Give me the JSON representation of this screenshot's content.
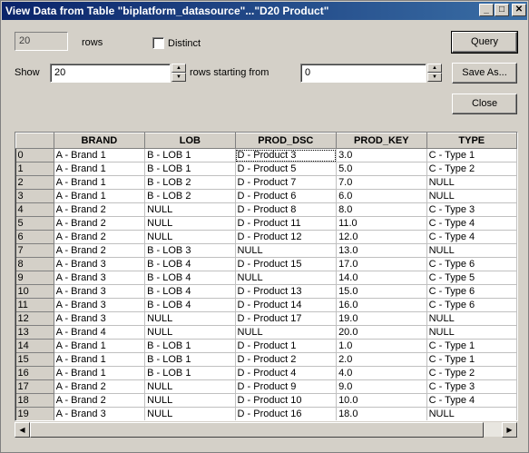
{
  "window": {
    "title": "View Data from Table \"biplatform_datasource\"...\"D20 Product\"",
    "minimize": "_",
    "maximize": "□",
    "close": "✕"
  },
  "controls": {
    "row_count": "20",
    "rows_label": "rows",
    "distinct_label": "Distinct",
    "distinct_checked": false,
    "show_label": "Show",
    "show_value": "20",
    "rows_starting_from_label": "rows starting from",
    "start_value": "0",
    "query_label": "Query",
    "save_as_label": "Save As...",
    "close_label": "Close"
  },
  "grid": {
    "columns": [
      "",
      "BRAND",
      "LOB",
      "PROD_DSC",
      "PROD_KEY",
      "TYPE"
    ],
    "rows": [
      [
        "0",
        "A - Brand 1",
        "B - LOB 1",
        "D - Product 3",
        "3.0",
        "C - Type 1"
      ],
      [
        "1",
        "A - Brand 1",
        "B - LOB 1",
        "D - Product 5",
        "5.0",
        "C - Type 2"
      ],
      [
        "2",
        "A - Brand 1",
        "B - LOB 2",
        "D - Product 7",
        "7.0",
        "NULL"
      ],
      [
        "3",
        "A - Brand 1",
        "B - LOB 2",
        "D - Product 6",
        "6.0",
        "NULL"
      ],
      [
        "4",
        "A - Brand 2",
        "NULL",
        "D - Product 8",
        "8.0",
        "C - Type 3"
      ],
      [
        "5",
        "A - Brand 2",
        "NULL",
        "D - Product 11",
        "11.0",
        "C - Type 4"
      ],
      [
        "6",
        "A - Brand 2",
        "NULL",
        "D - Product 12",
        "12.0",
        "C - Type 4"
      ],
      [
        "7",
        "A - Brand 2",
        "B - LOB 3",
        "NULL",
        "13.0",
        "NULL"
      ],
      [
        "8",
        "A - Brand 3",
        "B - LOB 4",
        "D - Product 15",
        "17.0",
        "C - Type 6"
      ],
      [
        "9",
        "A - Brand 3",
        "B - LOB 4",
        "NULL",
        "14.0",
        "C - Type 5"
      ],
      [
        "10",
        "A - Brand 3",
        "B - LOB 4",
        "D - Product 13",
        "15.0",
        "C - Type 6"
      ],
      [
        "11",
        "A - Brand 3",
        "B - LOB 4",
        "D - Product 14",
        "16.0",
        "C - Type 6"
      ],
      [
        "12",
        "A - Brand 3",
        "NULL",
        "D - Product 17",
        "19.0",
        "NULL"
      ],
      [
        "13",
        "A - Brand 4",
        "NULL",
        "NULL",
        "20.0",
        "NULL"
      ],
      [
        "14",
        "A - Brand 1",
        "B - LOB 1",
        "D - Product 1",
        "1.0",
        "C - Type 1"
      ],
      [
        "15",
        "A - Brand 1",
        "B - LOB 1",
        "D - Product 2",
        "2.0",
        "C - Type 1"
      ],
      [
        "16",
        "A - Brand 1",
        "B - LOB 1",
        "D - Product 4",
        "4.0",
        "C - Type 2"
      ],
      [
        "17",
        "A - Brand 2",
        "NULL",
        "D - Product 9",
        "9.0",
        "C - Type 3"
      ],
      [
        "18",
        "A - Brand 2",
        "NULL",
        "D - Product 10",
        "10.0",
        "C - Type 4"
      ],
      [
        "19",
        "A - Brand 3",
        "NULL",
        "D - Product 16",
        "18.0",
        "NULL"
      ]
    ]
  },
  "icons": {
    "spin_up": "▲",
    "spin_down": "▼",
    "scroll_left": "◀",
    "scroll_right": "▶"
  },
  "colors": {
    "titlebar_start": "#0a246a",
    "titlebar_end": "#3a6ea5",
    "face": "#d4d0c8"
  }
}
